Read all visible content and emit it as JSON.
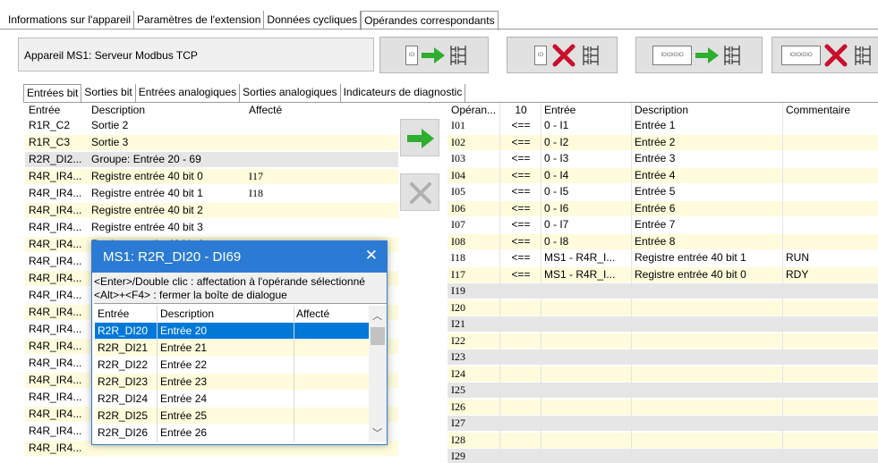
{
  "main_tabs": [
    "Informations sur l'appareil",
    "Paramètres de l'extension",
    "Données cycliques",
    "Opérandes correspondants"
  ],
  "device_label": "Appareil MS1: Serveur Modbus TCP",
  "toolbar": {
    "io_single": "IO",
    "io_multi": "IOIOIOIO"
  },
  "sub_tabs": [
    "Entrées bit",
    "Sorties bit",
    "Entrées analogiques",
    "Sorties analogiques",
    "Indicateurs de diagnostic"
  ],
  "left_table": {
    "headers": [
      "Entrée",
      "Description",
      "Affecté"
    ],
    "rows": [
      {
        "entree": "R1R_C2",
        "description": "Sortie 2",
        "affecte": ""
      },
      {
        "entree": "R1R_C3",
        "description": "Sortie 3",
        "affecte": ""
      },
      {
        "entree": "R2R_DI2...",
        "description": "Groupe: Entrée 20 -  69",
        "affecte": ""
      },
      {
        "entree": "R4R_IR4...",
        "description": "Registre entrée 40 bit 0",
        "affecte": "I17"
      },
      {
        "entree": "R4R_IR4...",
        "description": "Registre entrée 40 bit 1",
        "affecte": "I18"
      },
      {
        "entree": "R4R_IR4...",
        "description": "Registre entrée 40 bit 2",
        "affecte": ""
      },
      {
        "entree": "R4R_IR4...",
        "description": "Registre entrée 40 bit 3",
        "affecte": ""
      },
      {
        "entree": "R4R_IR4...",
        "description": "Registre entrée 40 bit 4",
        "affecte": ""
      },
      {
        "entree": "R4R_IR4...",
        "description": "",
        "affecte": ""
      },
      {
        "entree": "R4R_IR4...",
        "description": "",
        "affecte": ""
      },
      {
        "entree": "R4R_IR4...",
        "description": "",
        "affecte": ""
      },
      {
        "entree": "R4R_IR4...",
        "description": "",
        "affecte": ""
      },
      {
        "entree": "R4R_IR4...",
        "description": "",
        "affecte": ""
      },
      {
        "entree": "R4R_IR4...",
        "description": "",
        "affecte": ""
      },
      {
        "entree": "R4R_IR4...",
        "description": "",
        "affecte": ""
      },
      {
        "entree": "R4R_IR4...",
        "description": "",
        "affecte": ""
      },
      {
        "entree": "R4R_IR4...",
        "description": "",
        "affecte": ""
      },
      {
        "entree": "R4R_IR4...",
        "description": "",
        "affecte": ""
      },
      {
        "entree": "R4R_IR4...",
        "description": "",
        "affecte": ""
      },
      {
        "entree": "R4R_IR4...",
        "description": "",
        "affecte": ""
      }
    ]
  },
  "right_table": {
    "headers": [
      "Opéran...",
      "10",
      "Entrée",
      "Description",
      "Commentaire"
    ],
    "rows": [
      {
        "operande": "I01",
        "dir": "<==",
        "entree": "0 - I1",
        "description": "Entrée 1",
        "commentaire": ""
      },
      {
        "operande": "I02",
        "dir": "<==",
        "entree": "0 - I2",
        "description": "Entrée 2",
        "commentaire": ""
      },
      {
        "operande": "I03",
        "dir": "<==",
        "entree": "0 - I3",
        "description": "Entrée 3",
        "commentaire": ""
      },
      {
        "operande": "I04",
        "dir": "<==",
        "entree": "0 - I4",
        "description": "Entrée 4",
        "commentaire": ""
      },
      {
        "operande": "I05",
        "dir": "<==",
        "entree": "0 - I5",
        "description": "Entrée 5",
        "commentaire": ""
      },
      {
        "operande": "I06",
        "dir": "<==",
        "entree": "0 - I6",
        "description": "Entrée 6",
        "commentaire": ""
      },
      {
        "operande": "I07",
        "dir": "<==",
        "entree": "0 - I7",
        "description": "Entrée 7",
        "commentaire": ""
      },
      {
        "operande": "I08",
        "dir": "<==",
        "entree": "0 - I8",
        "description": "Entrée 8",
        "commentaire": ""
      },
      {
        "operande": "I18",
        "dir": "<==",
        "entree": "MS1 - R4R_I...",
        "description": "Registre entrée 40 bit 1",
        "commentaire": "RUN"
      },
      {
        "operande": "I17",
        "dir": "<==",
        "entree": "MS1 - R4R_I...",
        "description": "Registre entrée 40 bit 0",
        "commentaire": "RDY"
      },
      {
        "operande": "I19",
        "dir": "",
        "entree": "",
        "description": "",
        "commentaire": ""
      },
      {
        "operande": "I20",
        "dir": "",
        "entree": "",
        "description": "",
        "commentaire": ""
      },
      {
        "operande": "I21",
        "dir": "",
        "entree": "",
        "description": "",
        "commentaire": ""
      },
      {
        "operande": "I22",
        "dir": "",
        "entree": "",
        "description": "",
        "commentaire": ""
      },
      {
        "operande": "I23",
        "dir": "",
        "entree": "",
        "description": "",
        "commentaire": ""
      },
      {
        "operande": "I24",
        "dir": "",
        "entree": "",
        "description": "",
        "commentaire": ""
      },
      {
        "operande": "I25",
        "dir": "",
        "entree": "",
        "description": "",
        "commentaire": ""
      },
      {
        "operande": "I26",
        "dir": "",
        "entree": "",
        "description": "",
        "commentaire": ""
      },
      {
        "operande": "I27",
        "dir": "",
        "entree": "",
        "description": "",
        "commentaire": ""
      },
      {
        "operande": "I28",
        "dir": "",
        "entree": "",
        "description": "",
        "commentaire": ""
      },
      {
        "operande": "I29",
        "dir": "",
        "entree": "",
        "description": "",
        "commentaire": ""
      }
    ]
  },
  "dialog": {
    "title": "MS1: R2R_DI20 - DI69",
    "close_icon": "close-icon",
    "help_line1": "<Enter>/Double clic : affectation à l'opérande sélectionné",
    "help_line2": "<Alt>+<F4> : fermer la boîte de dialogue",
    "headers": [
      "Entrée",
      "Description",
      "Affecté"
    ],
    "rows": [
      {
        "entree": "R2R_DI20",
        "description": "Entrée 20",
        "affecte": ""
      },
      {
        "entree": "R2R_DI21",
        "description": "Entrée 21",
        "affecte": ""
      },
      {
        "entree": "R2R_DI22",
        "description": "Entrée 22",
        "affecte": ""
      },
      {
        "entree": "R2R_DI23",
        "description": "Entrée 23",
        "affecte": ""
      },
      {
        "entree": "R2R_DI24",
        "description": "Entrée 24",
        "affecte": ""
      },
      {
        "entree": "R2R_DI25",
        "description": "Entrée 25",
        "affecte": ""
      },
      {
        "entree": "R2R_DI26",
        "description": "Entrée 26",
        "affecte": ""
      }
    ]
  },
  "colors": {
    "row_yellow": "#fffbdc",
    "selected": "#0078d7",
    "dialog_title": "#2b7bd4",
    "arrow_green": "#2eae2e",
    "cross_red": "#c8102e"
  }
}
